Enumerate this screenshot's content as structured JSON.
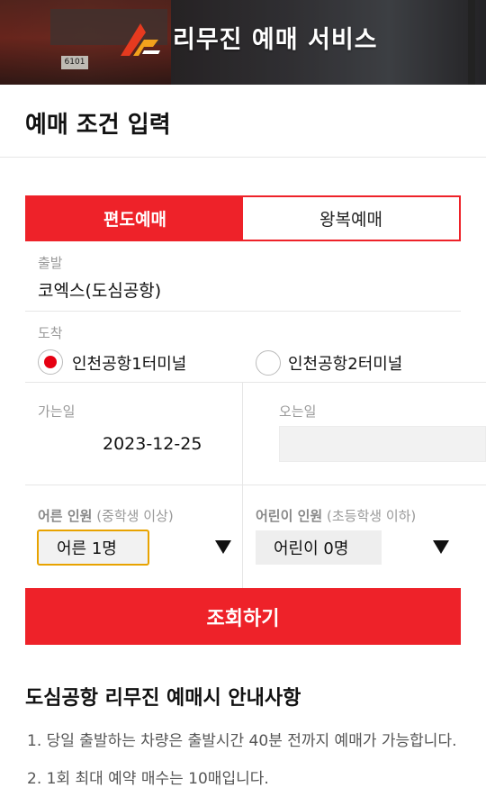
{
  "banner": {
    "title": "리무진 예매 서비스",
    "bus_plate": "6101"
  },
  "page": {
    "heading": "예매 조건 입력"
  },
  "tabs": [
    {
      "label": "편도예매",
      "active": true
    },
    {
      "label": "왕복예매",
      "active": false
    }
  ],
  "departure": {
    "label": "출발",
    "value": "코엑스(도심공항)"
  },
  "arrival": {
    "label": "도착",
    "options": [
      {
        "label": "인천공항1터미널",
        "selected": true
      },
      {
        "label": "인천공항2터미널",
        "selected": false
      }
    ]
  },
  "dates": {
    "go_label": "가는일",
    "go_value": "2023-12-25",
    "return_label": "오는일",
    "return_value": ""
  },
  "passengers": {
    "adult": {
      "label": "어른 인원",
      "note": "(중학생 이상)",
      "selected": "어른 1명"
    },
    "child": {
      "label": "어린이 인원",
      "note": "(초등학생 이하)",
      "selected": "어린이 0명"
    }
  },
  "search_button": {
    "label": "조회하기"
  },
  "notice": {
    "title": "도심공항 리무진 예매시 안내사항",
    "items": [
      "1. 당일 출발하는 차량은 출발시간 40분 전까지 예매가 가능합니다.",
      "2. 1회 최대 예약 매수는 10매입니다."
    ]
  },
  "colors": {
    "accent": "#ee2229",
    "highlight": "#e8a300",
    "radio_dot": "#e60012"
  }
}
